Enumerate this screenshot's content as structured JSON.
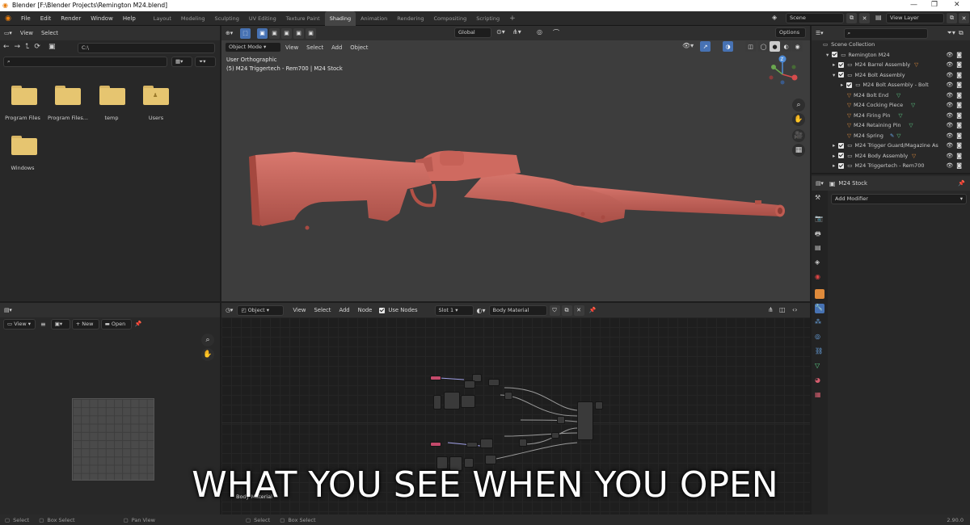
{
  "window": {
    "title": "Blender [F:\\Blender Projects\\Remington M24.blend]",
    "minimize": "—",
    "maximize": "❐",
    "close": "✕"
  },
  "menu": [
    "File",
    "Edit",
    "Render",
    "Window",
    "Help"
  ],
  "workspaces": [
    "Layout",
    "Modeling",
    "Sculpting",
    "UV Editing",
    "Texture Paint",
    "Shading",
    "Animation",
    "Rendering",
    "Compositing",
    "Scripting"
  ],
  "active_workspace": "Shading",
  "add_workspace": "+",
  "scene": {
    "name": "Scene",
    "view_layer": "View Layer"
  },
  "file_browser": {
    "header": {
      "view": "View",
      "select": "Select"
    },
    "path": "C:\\",
    "items": [
      {
        "label": "Program Files",
        "icon": "folder-icon"
      },
      {
        "label": "Program Files...",
        "icon": "folder-icon"
      },
      {
        "label": "temp",
        "icon": "folder-icon"
      },
      {
        "label": "Users",
        "icon": "folder-user-icon"
      },
      {
        "label": "Windows",
        "icon": "folder-icon"
      }
    ]
  },
  "viewport": {
    "mode": "Object Mode",
    "menus": [
      "View",
      "Select",
      "Add",
      "Object"
    ],
    "orientation": "Global",
    "options": "Options",
    "info_line1": "User Orthographic",
    "info_line2": "(5) M24 Triggertech - Rem700 | M24 Stock",
    "gizmo": {
      "z": "Z",
      "y": "Y",
      "x": "X"
    }
  },
  "image_editor": {
    "view": "View",
    "new": "New",
    "open": "Open"
  },
  "node_editor": {
    "type": "Object",
    "menus": [
      "View",
      "Select",
      "Add",
      "Node"
    ],
    "use_nodes": "Use Nodes",
    "slot": "Slot 1",
    "material": "Body Material",
    "footer_label": "Body Material"
  },
  "outliner": {
    "search_placeholder": "",
    "root": "Scene Collection",
    "items": [
      {
        "label": "Remington M24",
        "depth": 1,
        "type": "collection"
      },
      {
        "label": "M24 Barrel Assembly",
        "depth": 2,
        "type": "collection"
      },
      {
        "label": "M24 Bolt Assembly",
        "depth": 2,
        "type": "collection"
      },
      {
        "label": "M24 Bolt Assembly - Bolt",
        "depth": 3,
        "type": "collection"
      },
      {
        "label": "M24 Bolt End",
        "depth": 3,
        "type": "mesh"
      },
      {
        "label": "M24 Cocking Piece",
        "depth": 3,
        "type": "mesh"
      },
      {
        "label": "M24 Firing Pin",
        "depth": 3,
        "type": "mesh"
      },
      {
        "label": "M24 Retaining Pin",
        "depth": 3,
        "type": "mesh"
      },
      {
        "label": "M24 Spring",
        "depth": 3,
        "type": "mesh"
      },
      {
        "label": "M24 Trigger Guard/Magazine As",
        "depth": 2,
        "type": "collection"
      },
      {
        "label": "M24 Body Assembly",
        "depth": 2,
        "type": "collection"
      },
      {
        "label": "M24 Triggertech - Rem700",
        "depth": 2,
        "type": "collection"
      }
    ]
  },
  "properties": {
    "object_name": "M24 Stock",
    "add_modifier": "Add Modifier"
  },
  "status_bar": {
    "left": [
      "Select",
      "Box Select",
      "Pan View"
    ],
    "mid": [
      "Select",
      "Box Select"
    ],
    "version": "2.90.0"
  },
  "caption": "WHAT YOU SEE WHEN YOU OPEN",
  "colors": {
    "accent": "#4772b3",
    "rifle": "#c8655c",
    "folder": "#e6c570",
    "viewport_bg": "#3d3d3d",
    "active_ws": "#454545"
  }
}
